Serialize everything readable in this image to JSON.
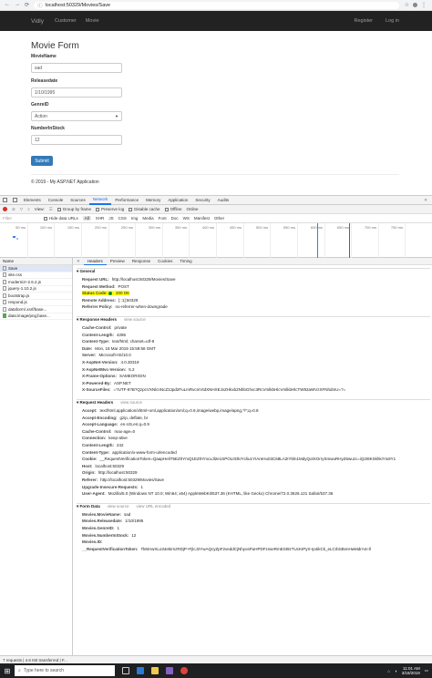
{
  "browser": {
    "url": "localhost:50329/Movies/Save",
    "back": "←",
    "forward": "→",
    "reload": "⟳",
    "star": "☆",
    "menu": "⋮"
  },
  "site": {
    "brand": "Vidly",
    "nav": [
      "Customer",
      "Movie"
    ],
    "register": "Register",
    "login": "Log in"
  },
  "form": {
    "title": "Movie Form",
    "fields": [
      {
        "label": "MovieName",
        "value": "sad"
      },
      {
        "label": "Releasedate",
        "value": "1/10/1995"
      },
      {
        "label": "GenreID",
        "value": "Action"
      },
      {
        "label": "NumberInStock",
        "value": "12"
      }
    ],
    "submit": "Submit",
    "footer": "© 2019 - My ASP.NET Application"
  },
  "devtools": {
    "tabs": [
      "Elements",
      "Console",
      "Sources",
      "Network",
      "Performance",
      "Memory",
      "Application",
      "Security",
      "Audits"
    ],
    "active_tab": "Network",
    "toolbar": [
      "View:",
      "Group by frame",
      "Preserve log",
      "Disable cache",
      "Offline",
      "Online"
    ],
    "filter": {
      "placeholder": "Filter",
      "hide": "Hide data URLs",
      "types": [
        "All",
        "XHR",
        "JS",
        "CSS",
        "Img",
        "Media",
        "Font",
        "Doc",
        "WS",
        "Manifest",
        "Other"
      ]
    },
    "ticks": [
      "50 ms",
      "100 ms",
      "150 ms",
      "200 ms",
      "250 ms",
      "300 ms",
      "350 ms",
      "400 ms",
      "450 ms",
      "500 ms",
      "550 ms",
      "600 ms",
      "650 ms",
      "700 ms",
      "750 ms"
    ],
    "list_header": "Name",
    "requests": [
      "Save",
      "site.css",
      "modernizr-2.6.2.js",
      "jquery-1.10.2.js",
      "bootstrap.js",
      "respond.js",
      "dataform/.xsrf/base...",
      "data:image/png;base..."
    ],
    "detail_tabs": [
      "Headers",
      "Preview",
      "Response",
      "Cookies",
      "Timing"
    ],
    "general": {
      "title": "General",
      "rows": [
        {
          "k": "Request URL:",
          "v": "http://localhost:50329/Movies/Save"
        },
        {
          "k": "Request Method:",
          "v": "POST"
        },
        {
          "k": "Status Code:",
          "v": "200 OK"
        },
        {
          "k": "Remote Address:",
          "v": "[::1]:50329"
        },
        {
          "k": "Referrer Policy:",
          "v": "no-referrer-when-downgrade"
        }
      ]
    },
    "response_headers": {
      "title": "Response Headers",
      "view": "view source",
      "rows": [
        {
          "k": "Cache-Control:",
          "v": "private"
        },
        {
          "k": "Content-Length:",
          "v": "4286"
        },
        {
          "k": "Content-Type:",
          "v": "text/html; charset=utf-8"
        },
        {
          "k": "Date:",
          "v": "Mon, 18 Mar 2019 15:59:58 GMT"
        },
        {
          "k": "Server:",
          "v": "Microsoft-IIS/10.0"
        },
        {
          "k": "X-AspNet-Version:",
          "v": "4.0.30319"
        },
        {
          "k": "X-AspNetMvc-Version:",
          "v": "5.2"
        },
        {
          "k": "X-Frame-Options:",
          "v": "SAMEORIGIN"
        },
        {
          "k": "X-Powered-By:",
          "v": "ASP.NET"
        },
        {
          "k": "X-SourceFiles:",
          "v": "=?UTF-8?B?QzpcVXNlcnNcZ3Jpd2FuLmRvcmVtdXNHXEJvZHkxb2NhbGhvc3RcVmlkbHlcVmlkbHlcTW92aWVzXFNhdmU=?="
        }
      ]
    },
    "request_headers": {
      "title": "Request Headers",
      "view": "view source",
      "rows": [
        {
          "k": "Accept:",
          "v": "text/html,application/xhtml+xml,application/xml;q=0.9,image/webp,image/apng,*/*;q=0.8"
        },
        {
          "k": "Accept-Encoding:",
          "v": "gzip, deflate, br"
        },
        {
          "k": "Accept-Language:",
          "v": "en-US,en;q=0.9"
        },
        {
          "k": "Cache-Control:",
          "v": "max-age=0"
        },
        {
          "k": "Connection:",
          "v": "keep-alive"
        },
        {
          "k": "Content-Length:",
          "v": "242"
        },
        {
          "k": "Content-Type:",
          "v": "application/x-www-form-urlencoded"
        },
        {
          "k": "Cookie:",
          "v": "__RequestVerificationToken=QaapHeliT5EZ0YmQ1EZ0YmcxJl2e1SPOL0OkIYcliu1YIAreHu03C68LA2IYbln1MdyQotXOrrySmwuRHyZ6wuzc=iQ2I8KSkhkiYIx9Y1"
        },
        {
          "k": "Host:",
          "v": "localhost:50329"
        },
        {
          "k": "Origin:",
          "v": "http://localhost:50329"
        },
        {
          "k": "Referer:",
          "v": "http://localhost:50329/Movies/Save"
        },
        {
          "k": "Upgrade-Insecure-Requests:",
          "v": "1"
        },
        {
          "k": "User-Agent:",
          "v": "Mozilla/5.0 (Windows NT 10.0; Win64; x64) AppleWebKit/537.36 (KHTML, like Gecko) Chrome/72.0.3626.121 Safari/537.36"
        }
      ]
    },
    "form_data": {
      "title": "Form Data",
      "view": "view source",
      "view2": "view URL encoded",
      "rows": [
        {
          "k": "Movies.MovieName:",
          "v": "sad"
        },
        {
          "k": "Movies.Releasedate:",
          "v": "1/10/1995"
        },
        {
          "k": "Movies.GenreID:",
          "v": "1"
        },
        {
          "k": "Movies.NumberInStock:",
          "v": "12"
        },
        {
          "k": "Movies.ID:",
          "v": ""
        },
        {
          "k": "__RequestVerificationToken:",
          "v": "TkMAwXLo34ekImzRDjP+FjlcJ2YwAQcyZpF2veddCjNhyosPuHPDFzsseRmESt9zTUcKIPyX-Ip4ikCk_eLCrbSBvnHwMdrAm-ll"
        }
      ]
    },
    "status": "7 requests | 4.6 KB transferred | F..."
  },
  "taskbar": {
    "search": "Type here to search",
    "time": "11:01 AM",
    "date": "3/18/2019"
  }
}
